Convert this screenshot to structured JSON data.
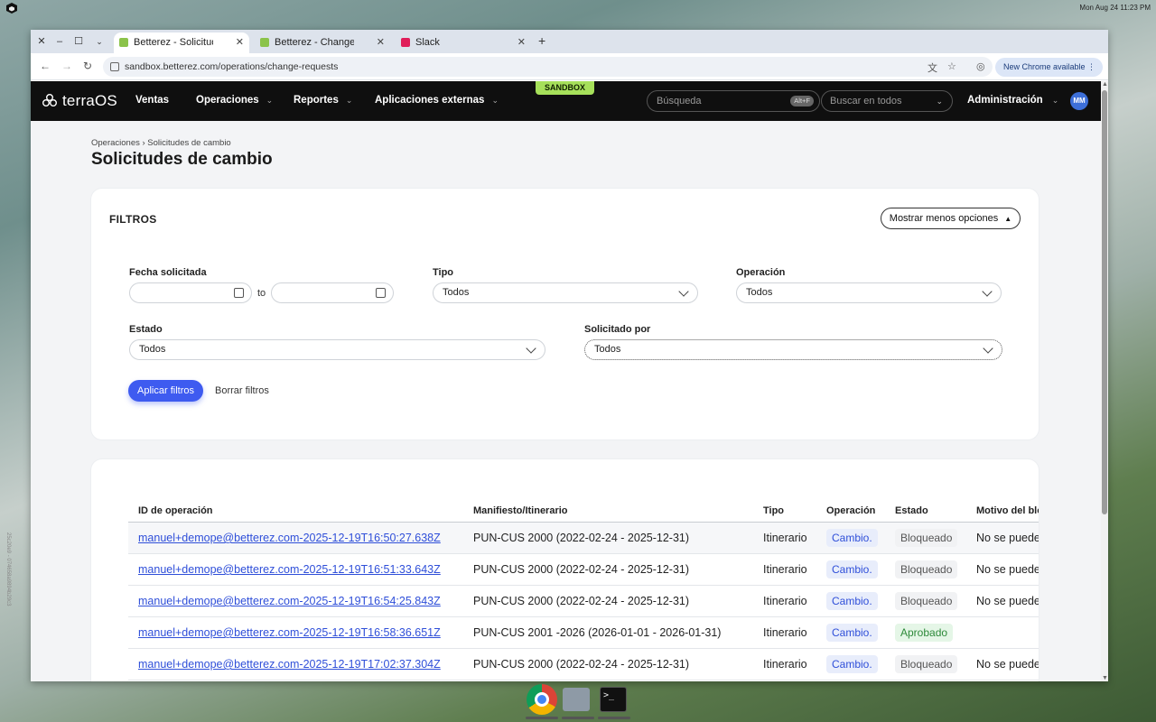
{
  "os": {
    "clock": "Mon Aug 24  11:23 PM",
    "logo_icon": "cube-icon"
  },
  "browser": {
    "tabs": [
      {
        "title": "Betterez - Solicitudes de cambio",
        "active": true,
        "favicon_color": "#8bc34a"
      },
      {
        "title": "Betterez - Change Requests",
        "active": false,
        "favicon_color": "#8bc34a"
      },
      {
        "title": "Slack",
        "active": false,
        "favicon_color": "#e01e5a"
      }
    ],
    "url": "sandbox.betterez.com/operations/change-requests",
    "new_chrome_label": "New Chrome available"
  },
  "app": {
    "logo_text": "terraOS",
    "sandbox_label": "SANDBOX",
    "nav": {
      "ventas": "Ventas",
      "operaciones": "Operaciones",
      "reportes": "Reportes",
      "aplicaciones": "Aplicaciones externas"
    },
    "search_placeholder": "Búsqueda",
    "search_shortcut": "Alt+F",
    "search_scope": "Buscar en todos",
    "admin_label": "Administración",
    "avatar_initials": "MM",
    "accent_color": "#3e5bf0"
  },
  "page": {
    "breadcrumb": "Operaciones › Solicitudes de cambio",
    "title": "Solicitudes de cambio"
  },
  "filters": {
    "title": "FILTROS",
    "toggle_label": "Mostrar menos opciones",
    "fecha_label": "Fecha solicitada",
    "fecha_from": "",
    "fecha_to": "",
    "to_label": "to",
    "tipo_label": "Tipo",
    "tipo_value": "Todos",
    "operacion_label": "Operación",
    "operacion_value": "Todos",
    "estado_label": "Estado",
    "estado_value": "Todos",
    "solicitado_label": "Solicitado por",
    "solicitado_value": "Todos",
    "apply_label": "Aplicar filtros",
    "clear_label": "Borrar filtros"
  },
  "table": {
    "headers": {
      "id": "ID de operación",
      "manifest": "Manifiesto/Itinerario",
      "type": "Tipo",
      "operation": "Operación",
      "status": "Estado",
      "reason": "Motivo del blo"
    },
    "rows": [
      {
        "id": "manuel+demope@betterez.com-2025-12-19T16:50:27.638Z",
        "manifest": "PUN-CUS 2000 (2022-02-24 - 2025-12-31)",
        "type": "Itinerario",
        "operation": "Cambio.",
        "status": "Bloqueado",
        "status_kind": "blocked",
        "reason": "No se puede"
      },
      {
        "id": "manuel+demope@betterez.com-2025-12-19T16:51:33.643Z",
        "manifest": "PUN-CUS 2000 (2022-02-24 - 2025-12-31)",
        "type": "Itinerario",
        "operation": "Cambio.",
        "status": "Bloqueado",
        "status_kind": "blocked",
        "reason": "No se puede"
      },
      {
        "id": "manuel+demope@betterez.com-2025-12-19T16:54:25.843Z",
        "manifest": "PUN-CUS 2000 (2022-02-24 - 2025-12-31)",
        "type": "Itinerario",
        "operation": "Cambio.",
        "status": "Bloqueado",
        "status_kind": "blocked",
        "reason": "No se puede"
      },
      {
        "id": "manuel+demope@betterez.com-2025-12-19T16:58:36.651Z",
        "manifest": "PUN-CUS 2001 -2026 (2026-01-01 - 2026-01-31)",
        "type": "Itinerario",
        "operation": "Cambio.",
        "status": "Aprobado",
        "status_kind": "approved",
        "reason": ""
      },
      {
        "id": "manuel+demope@betterez.com-2025-12-19T17:02:37.304Z",
        "manifest": "PUN-CUS 2000 (2022-02-24 - 2025-12-31)",
        "type": "Itinerario",
        "operation": "Cambio.",
        "status": "Bloqueado",
        "status_kind": "blocked",
        "reason": "No se puede"
      }
    ]
  },
  "side_text": "25c20e9 - 074658a9894b29c3"
}
